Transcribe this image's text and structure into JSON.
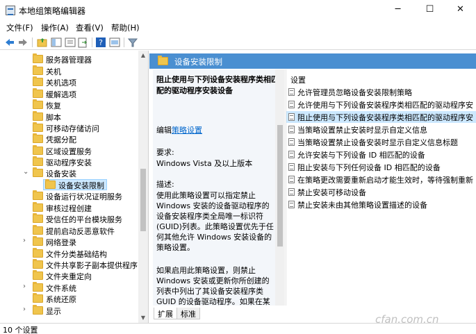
{
  "window": {
    "title": "本地组策略编辑器",
    "controls": [
      "─",
      "☐",
      "✕"
    ]
  },
  "menu": {
    "items": [
      "文件(F)",
      "操作(A)",
      "查看(V)",
      "帮助(H)"
    ]
  },
  "toolbar": {
    "buttons": [
      "back-icon",
      "forward-icon",
      "up-folder-icon",
      "show-tree-icon",
      "export-list-icon",
      "help-icon",
      "properties-icon",
      "filter-icon"
    ]
  },
  "tree": {
    "items": [
      {
        "label": "服务器管理器"
      },
      {
        "label": "关机"
      },
      {
        "label": "关机选项"
      },
      {
        "label": "缓解选项"
      },
      {
        "label": "恢复"
      },
      {
        "label": "脚本"
      },
      {
        "label": "可移动存储访问"
      },
      {
        "label": "凭据分配"
      },
      {
        "label": "区域设置服务"
      },
      {
        "label": "驱动程序安装"
      },
      {
        "label": "设备安装",
        "expanded": true
      },
      {
        "label": "设备安装限制",
        "selected": true
      },
      {
        "label": "设备运行状况证明服务"
      },
      {
        "label": "审核过程创建"
      },
      {
        "label": "受信任的平台模块服务"
      },
      {
        "label": "提前启动反恶意软件"
      },
      {
        "label": "网络登录"
      },
      {
        "label": "文件分类基础结构"
      },
      {
        "label": "文件共享影子副本提供程序"
      },
      {
        "label": "文件夹重定向"
      },
      {
        "label": "文件系统"
      },
      {
        "label": "系统还原"
      },
      {
        "label": "显示"
      }
    ]
  },
  "details": {
    "header": "设备安装限制",
    "policy_title": "阻止使用与下列设备安装程序类相匹配的驱动程序安装设备",
    "edit_prefix": "编辑",
    "edit_link": "策略设置",
    "requirements_label": "要求:",
    "requirements_value": "Windows Vista 及以上版本",
    "description_label": "描述:",
    "description_p1": "使用此策略设置可以指定禁止 Windows 安装的设备驱动程序的设备安装程序类全局唯一标识符(GUID)列表。此策略设置优先于任何其他允许 Windows 安装设备的策略设置。",
    "description_p2": "如果启用此策略设置，则禁止 Windows 安装或更新你所创建的列表中列出了其设备安装程序类 GUID 的设备驱动程序。如果在某个远程桌面服务器上启用了此策略设置，则此策略设置会影响指定设"
  },
  "settings": {
    "column_header": "设置",
    "items": [
      {
        "label": "允许管理员忽略设备安装限制策略"
      },
      {
        "label": "允许使用与下列设备安装程序类相匹配的驱动程序安"
      },
      {
        "label": "阻止使用与下列设备安装程序类相匹配的驱动程序安",
        "selected": true
      },
      {
        "label": "当策略设置禁止安装时显示自定义信息"
      },
      {
        "label": "当策略设置禁止设备安装时显示自定义信息标题"
      },
      {
        "label": "允许安装与下列设备 ID 相匹配的设备"
      },
      {
        "label": "阻止安装与下列任何设备 ID 相匹配的设备"
      },
      {
        "label": "在策略更改需要重新启动才能生效时，等待强制重新"
      },
      {
        "label": "禁止安装可移动设备"
      },
      {
        "label": "禁止安装未由其他策略设置描述的设备"
      }
    ]
  },
  "tabs": [
    "扩展",
    "标准"
  ],
  "status": {
    "text": "10 个设置"
  },
  "watermark": "cfan.com.cn",
  "colors": {
    "header_band": "#4a8fd1",
    "selection": "#cce8ff",
    "link": "#0066cc"
  }
}
